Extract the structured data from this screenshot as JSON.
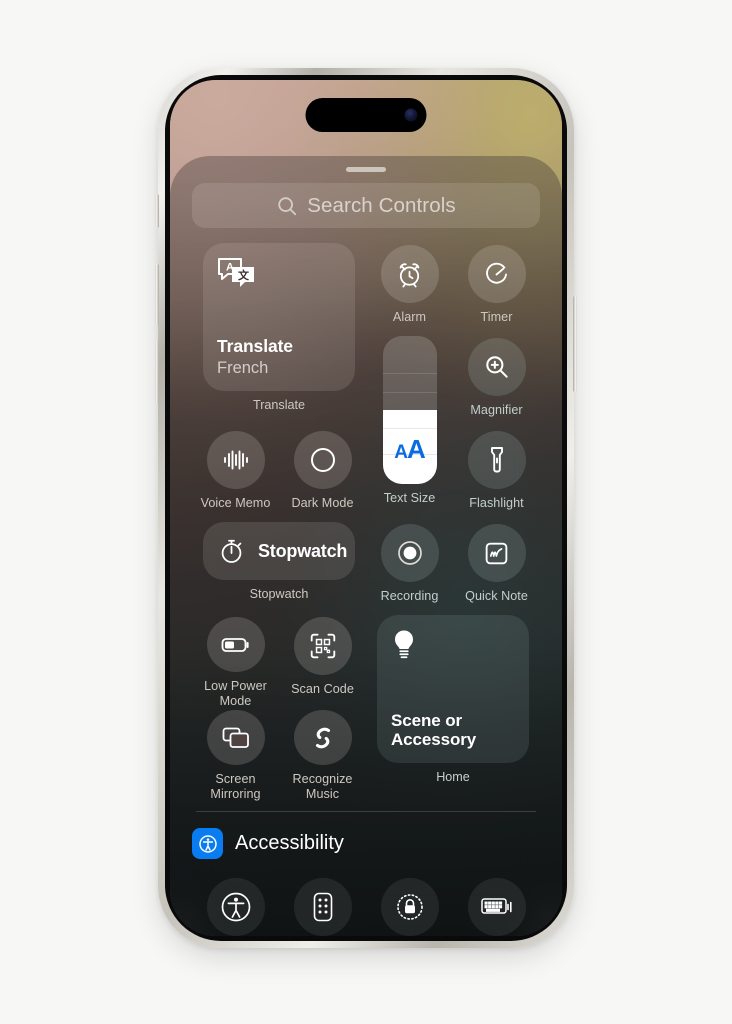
{
  "page": {
    "background_color": "#f7f7f5",
    "device": "iPhone",
    "screen_title": "Control Center"
  },
  "wallpaper": {
    "top_left_color": "#c6a397",
    "top_right_color": "#bcae6c",
    "bottom_color": "#2a3638"
  },
  "control_center": {
    "grabber": "drag-handle",
    "search": {
      "placeholder": "Search Controls",
      "icon": "search-icon"
    },
    "controls": [
      {
        "id": "translate",
        "type": "tile",
        "icon": "translate-icon",
        "title": "Translate",
        "subtitle": "French",
        "caption": "Translate"
      },
      {
        "id": "alarm",
        "type": "round",
        "icon": "alarm-clock-icon",
        "label": "Alarm"
      },
      {
        "id": "timer",
        "type": "round",
        "icon": "timer-icon",
        "label": "Timer"
      },
      {
        "id": "text-size",
        "type": "slider",
        "icon": "text-size-icon",
        "label": "Text Size",
        "value_percent": 50,
        "glyph_small": "A",
        "glyph_large": "A",
        "glyph_color": "#0b6ce0"
      },
      {
        "id": "magnifier",
        "type": "round",
        "icon": "magnifier-icon",
        "label": "Magnifier"
      },
      {
        "id": "voice-memo",
        "type": "round",
        "icon": "waveform-icon",
        "label": "Voice Memo"
      },
      {
        "id": "dark-mode",
        "type": "round",
        "icon": "dark-mode-icon",
        "label": "Dark Mode"
      },
      {
        "id": "flashlight",
        "type": "round",
        "icon": "flashlight-icon",
        "label": "Flashlight"
      },
      {
        "id": "stopwatch",
        "type": "tile",
        "icon": "stopwatch-icon",
        "title": "Stopwatch",
        "caption": "Stopwatch"
      },
      {
        "id": "recording",
        "type": "round",
        "icon": "record-icon",
        "label": "Recording"
      },
      {
        "id": "quick-note",
        "type": "round",
        "icon": "quick-note-icon",
        "label": "Quick Note"
      },
      {
        "id": "low-power-mode",
        "type": "round",
        "icon": "battery-icon",
        "label": "Low Power Mode"
      },
      {
        "id": "scan-code",
        "type": "round",
        "icon": "qr-scan-icon",
        "label": "Scan Code"
      },
      {
        "id": "home-scene",
        "type": "tile",
        "icon": "lightbulb-icon",
        "title": "Scene or Accessory",
        "caption": "Home"
      },
      {
        "id": "screen-mirroring",
        "type": "round",
        "icon": "screen-mirroring-icon",
        "label": "Screen Mirroring"
      },
      {
        "id": "recognize-music",
        "type": "round",
        "icon": "shazam-icon",
        "label": "Recognize Music"
      }
    ],
    "accessibility_section": {
      "badge_icon": "accessibility-icon",
      "badge_color": "#0a7cf1",
      "title": "Accessibility",
      "controls": [
        {
          "id": "assistive-touch",
          "icon": "assistive-touch-icon"
        },
        {
          "id": "apple-tv-remote",
          "icon": "tv-remote-icon"
        },
        {
          "id": "guided-access",
          "icon": "guided-access-lock-icon"
        },
        {
          "id": "live-speech",
          "icon": "keyboard-speech-icon"
        }
      ]
    }
  }
}
